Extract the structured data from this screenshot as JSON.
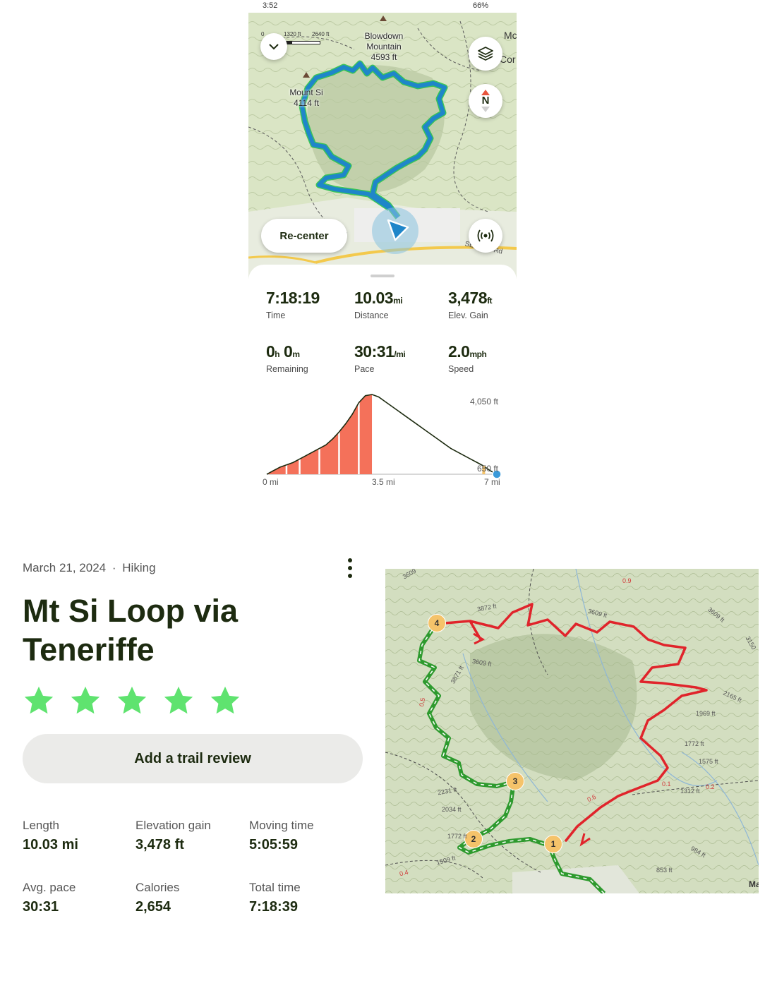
{
  "status_bar": {
    "time": "3:52",
    "battery": "66%"
  },
  "map1": {
    "scale_labels": [
      "0",
      "1320 ft",
      "2640 ft"
    ],
    "peaks": [
      {
        "name_line1": "Blowdown",
        "name_line2": "Mountain",
        "elev": "4593 ft"
      },
      {
        "name_line1": "Mount Si",
        "elev": "4114 ft"
      }
    ],
    "edge_labels": [
      "Mc",
      "Cor"
    ],
    "road_label": "SE Mt Si Rd",
    "compass_label": "N",
    "recenter_label": "Re-center"
  },
  "stats": {
    "time": {
      "value": "7:18:19",
      "label": "Time"
    },
    "distance": {
      "value": "10.03",
      "unit": "mi",
      "label": "Distance"
    },
    "elev_gain": {
      "value": "3,478",
      "unit": "ft",
      "label": "Elev. Gain"
    },
    "remaining": {
      "h": "0",
      "h_unit": "h",
      "m": "0",
      "m_unit": "m",
      "label": "Remaining"
    },
    "pace": {
      "value": "30:31",
      "unit": "/mi",
      "label": "Pace"
    },
    "speed": {
      "value": "2.0",
      "unit": "mph",
      "label": "Speed"
    }
  },
  "chart_data": {
    "type": "area",
    "title": "",
    "xlabel": "",
    "ylabel": "",
    "x_ticks": [
      "0 mi",
      "3.5 mi",
      "7 mi"
    ],
    "y_labels": [
      "4,050 ft",
      "650 ft"
    ],
    "xlim": [
      0,
      7
    ],
    "ylim": [
      650,
      4050
    ],
    "x": [
      0,
      0.2,
      0.4,
      0.6,
      0.8,
      1.0,
      1.2,
      1.4,
      1.6,
      1.8,
      2.0,
      2.2,
      2.4,
      2.6,
      2.8,
      3.0,
      3.2,
      3.4,
      3.6,
      3.8,
      4.0,
      4.2,
      4.4,
      4.6,
      4.8,
      5.0,
      5.2,
      5.4,
      5.6,
      5.8,
      6.0,
      6.2,
      6.4,
      6.6,
      6.8,
      7.0
    ],
    "y": [
      650,
      800,
      950,
      1050,
      1150,
      1300,
      1450,
      1600,
      1750,
      1900,
      2150,
      2450,
      2800,
      3200,
      3700,
      4000,
      4050,
      3950,
      3750,
      3550,
      3350,
      3150,
      2950,
      2750,
      2550,
      2350,
      2150,
      1950,
      1750,
      1600,
      1450,
      1300,
      1150,
      1000,
      800,
      650
    ],
    "completed_to_x": 3.2,
    "colors": {
      "completed": "#f4715a",
      "line": "#1d2b10",
      "marker": "#f5c36a"
    }
  },
  "activity": {
    "date": "March 21, 2024",
    "separator": "·",
    "type": "Hiking",
    "title": "Mt Si Loop via Teneriffe",
    "rating": 5,
    "review_button": "Add a trail review",
    "stats": [
      {
        "label": "Length",
        "value": "10.03 mi"
      },
      {
        "label": "Elevation gain",
        "value": "3,478 ft"
      },
      {
        "label": "Moving time",
        "value": "5:05:59"
      },
      {
        "label": "Avg. pace",
        "value": "30:31"
      },
      {
        "label": "Calories",
        "value": "2,654"
      },
      {
        "label": "Total time",
        "value": "7:18:39"
      }
    ]
  },
  "map2": {
    "waypoints": [
      "1",
      "2",
      "3",
      "4"
    ],
    "contour_labels": [
      "3872 ft",
      "3609 ft",
      "3609 ft",
      "3609 ft",
      "3871 ft",
      "2231 ft",
      "2034 ft",
      "1772 ft",
      "1509 ft",
      "2165 ft",
      "1969 ft",
      "1772 ft",
      "1575 ft",
      "1312 ft",
      "984 ft",
      "853 ft",
      "3609",
      "3150"
    ],
    "distance_labels": [
      "0.9",
      "0.5",
      "0.6",
      "0.1",
      "0.2",
      "0.4"
    ],
    "edge_label": "Ma",
    "colors": {
      "red_route": "#e0242b",
      "green_route": "#2e9a2e",
      "waypoint": "#f5c36a"
    }
  },
  "colors": {
    "brand_green": "#1d2b10",
    "star_green": "#5fe36f",
    "route_blue": "#1f86c9"
  }
}
